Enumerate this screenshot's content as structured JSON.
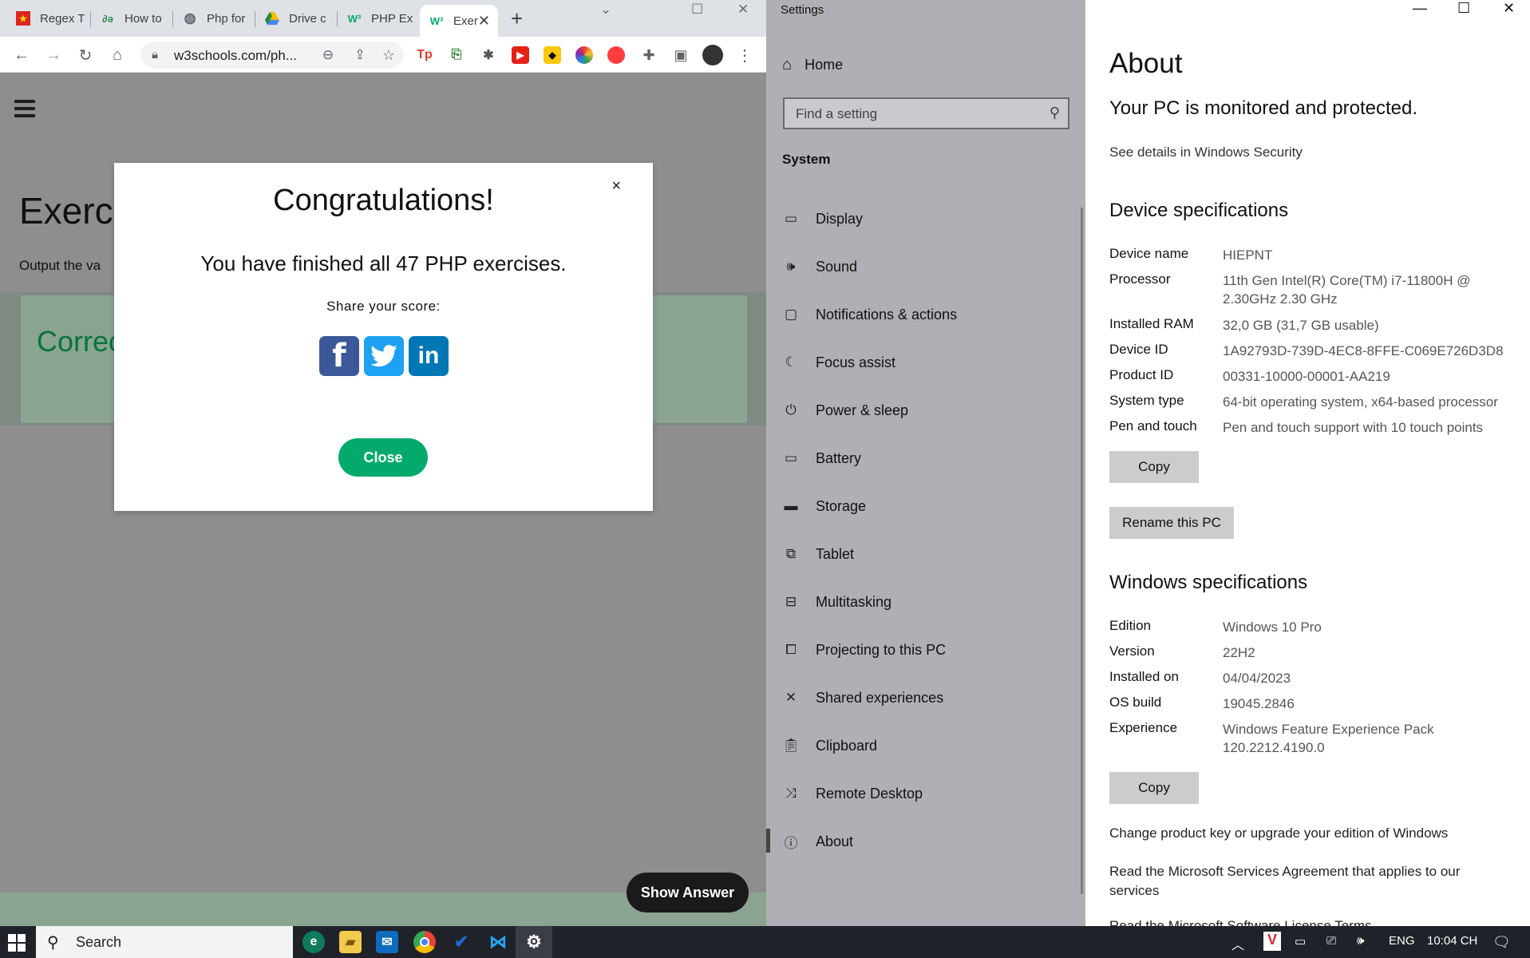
{
  "browser": {
    "tabs": [
      {
        "title": "Regex T",
        "favicon": "vietnam-flag-icon"
      },
      {
        "title": "How to",
        "favicon": "geeks-icon"
      },
      {
        "title": "Php for",
        "favicon": "globe-icon"
      },
      {
        "title": "Drive c",
        "favicon": "drive-icon"
      },
      {
        "title": "PHP Ex",
        "favicon": "w3schools-icon"
      },
      {
        "title": "Exer",
        "favicon": "w3schools-icon"
      }
    ],
    "url": "w3schools.com/ph..."
  },
  "page": {
    "exercise_title": "Exerci",
    "exercise_desc": "Output the va",
    "correct_text": "Correc",
    "show_answer": "Show Answer"
  },
  "modal": {
    "close_x": "×",
    "title": "Congratulations!",
    "finished": "You have finished all 47 PHP exercises.",
    "share": "Share your score:",
    "close": "Close",
    "social": {
      "facebook": "f",
      "linkedin": "in"
    },
    "colors": {
      "facebook": "#3b5998",
      "twitter": "#1da1f2",
      "linkedin": "#0077b5",
      "close": "#04aa6d"
    }
  },
  "settings": {
    "window_title": "Settings",
    "home": "Home",
    "search_placeholder": "Find a setting",
    "section": "System",
    "nav": [
      "Display",
      "Sound",
      "Notifications & actions",
      "Focus assist",
      "Power & sleep",
      "Battery",
      "Storage",
      "Tablet",
      "Multitasking",
      "Projecting to this PC",
      "Shared experiences",
      "Clipboard",
      "Remote Desktop",
      "About"
    ],
    "about": {
      "title": "About",
      "protected": "Your PC is monitored and protected.",
      "security_link": "See details in Windows Security",
      "device_heading": "Device specifications",
      "device_specs": [
        {
          "k": "Device name",
          "v": "HIEPNT"
        },
        {
          "k": "Processor",
          "v": "11th Gen Intel(R) Core(TM) i7-11800H @ 2.30GHz   2.30 GHz"
        },
        {
          "k": "Installed RAM",
          "v": "32,0 GB (31,7 GB usable)"
        },
        {
          "k": "Device ID",
          "v": "1A92793D-739D-4EC8-8FFE-C069E726D3D8"
        },
        {
          "k": "Product ID",
          "v": "00331-10000-00001-AA219"
        },
        {
          "k": "System type",
          "v": "64-bit operating system, x64-based processor"
        },
        {
          "k": "Pen and touch",
          "v": "Pen and touch support with 10 touch points"
        }
      ],
      "copy": "Copy",
      "rename": "Rename this PC",
      "windows_heading": "Windows specifications",
      "windows_specs": [
        {
          "k": "Edition",
          "v": "Windows 10 Pro"
        },
        {
          "k": "Version",
          "v": "22H2"
        },
        {
          "k": "Installed on",
          "v": "04/04/2023"
        },
        {
          "k": "OS build",
          "v": "19045.2846"
        },
        {
          "k": "Experience",
          "v": "Windows Feature Experience Pack 120.2212.4190.0"
        }
      ],
      "copy2": "Copy",
      "change_key": "Change product key or upgrade your edition of Windows",
      "msa": "Read the Microsoft Services Agreement that applies to our services",
      "license": "Read the Microsoft Software License Terms"
    }
  },
  "taskbar": {
    "search": "Search",
    "lang": "ENG",
    "time": "10:04 CH"
  }
}
